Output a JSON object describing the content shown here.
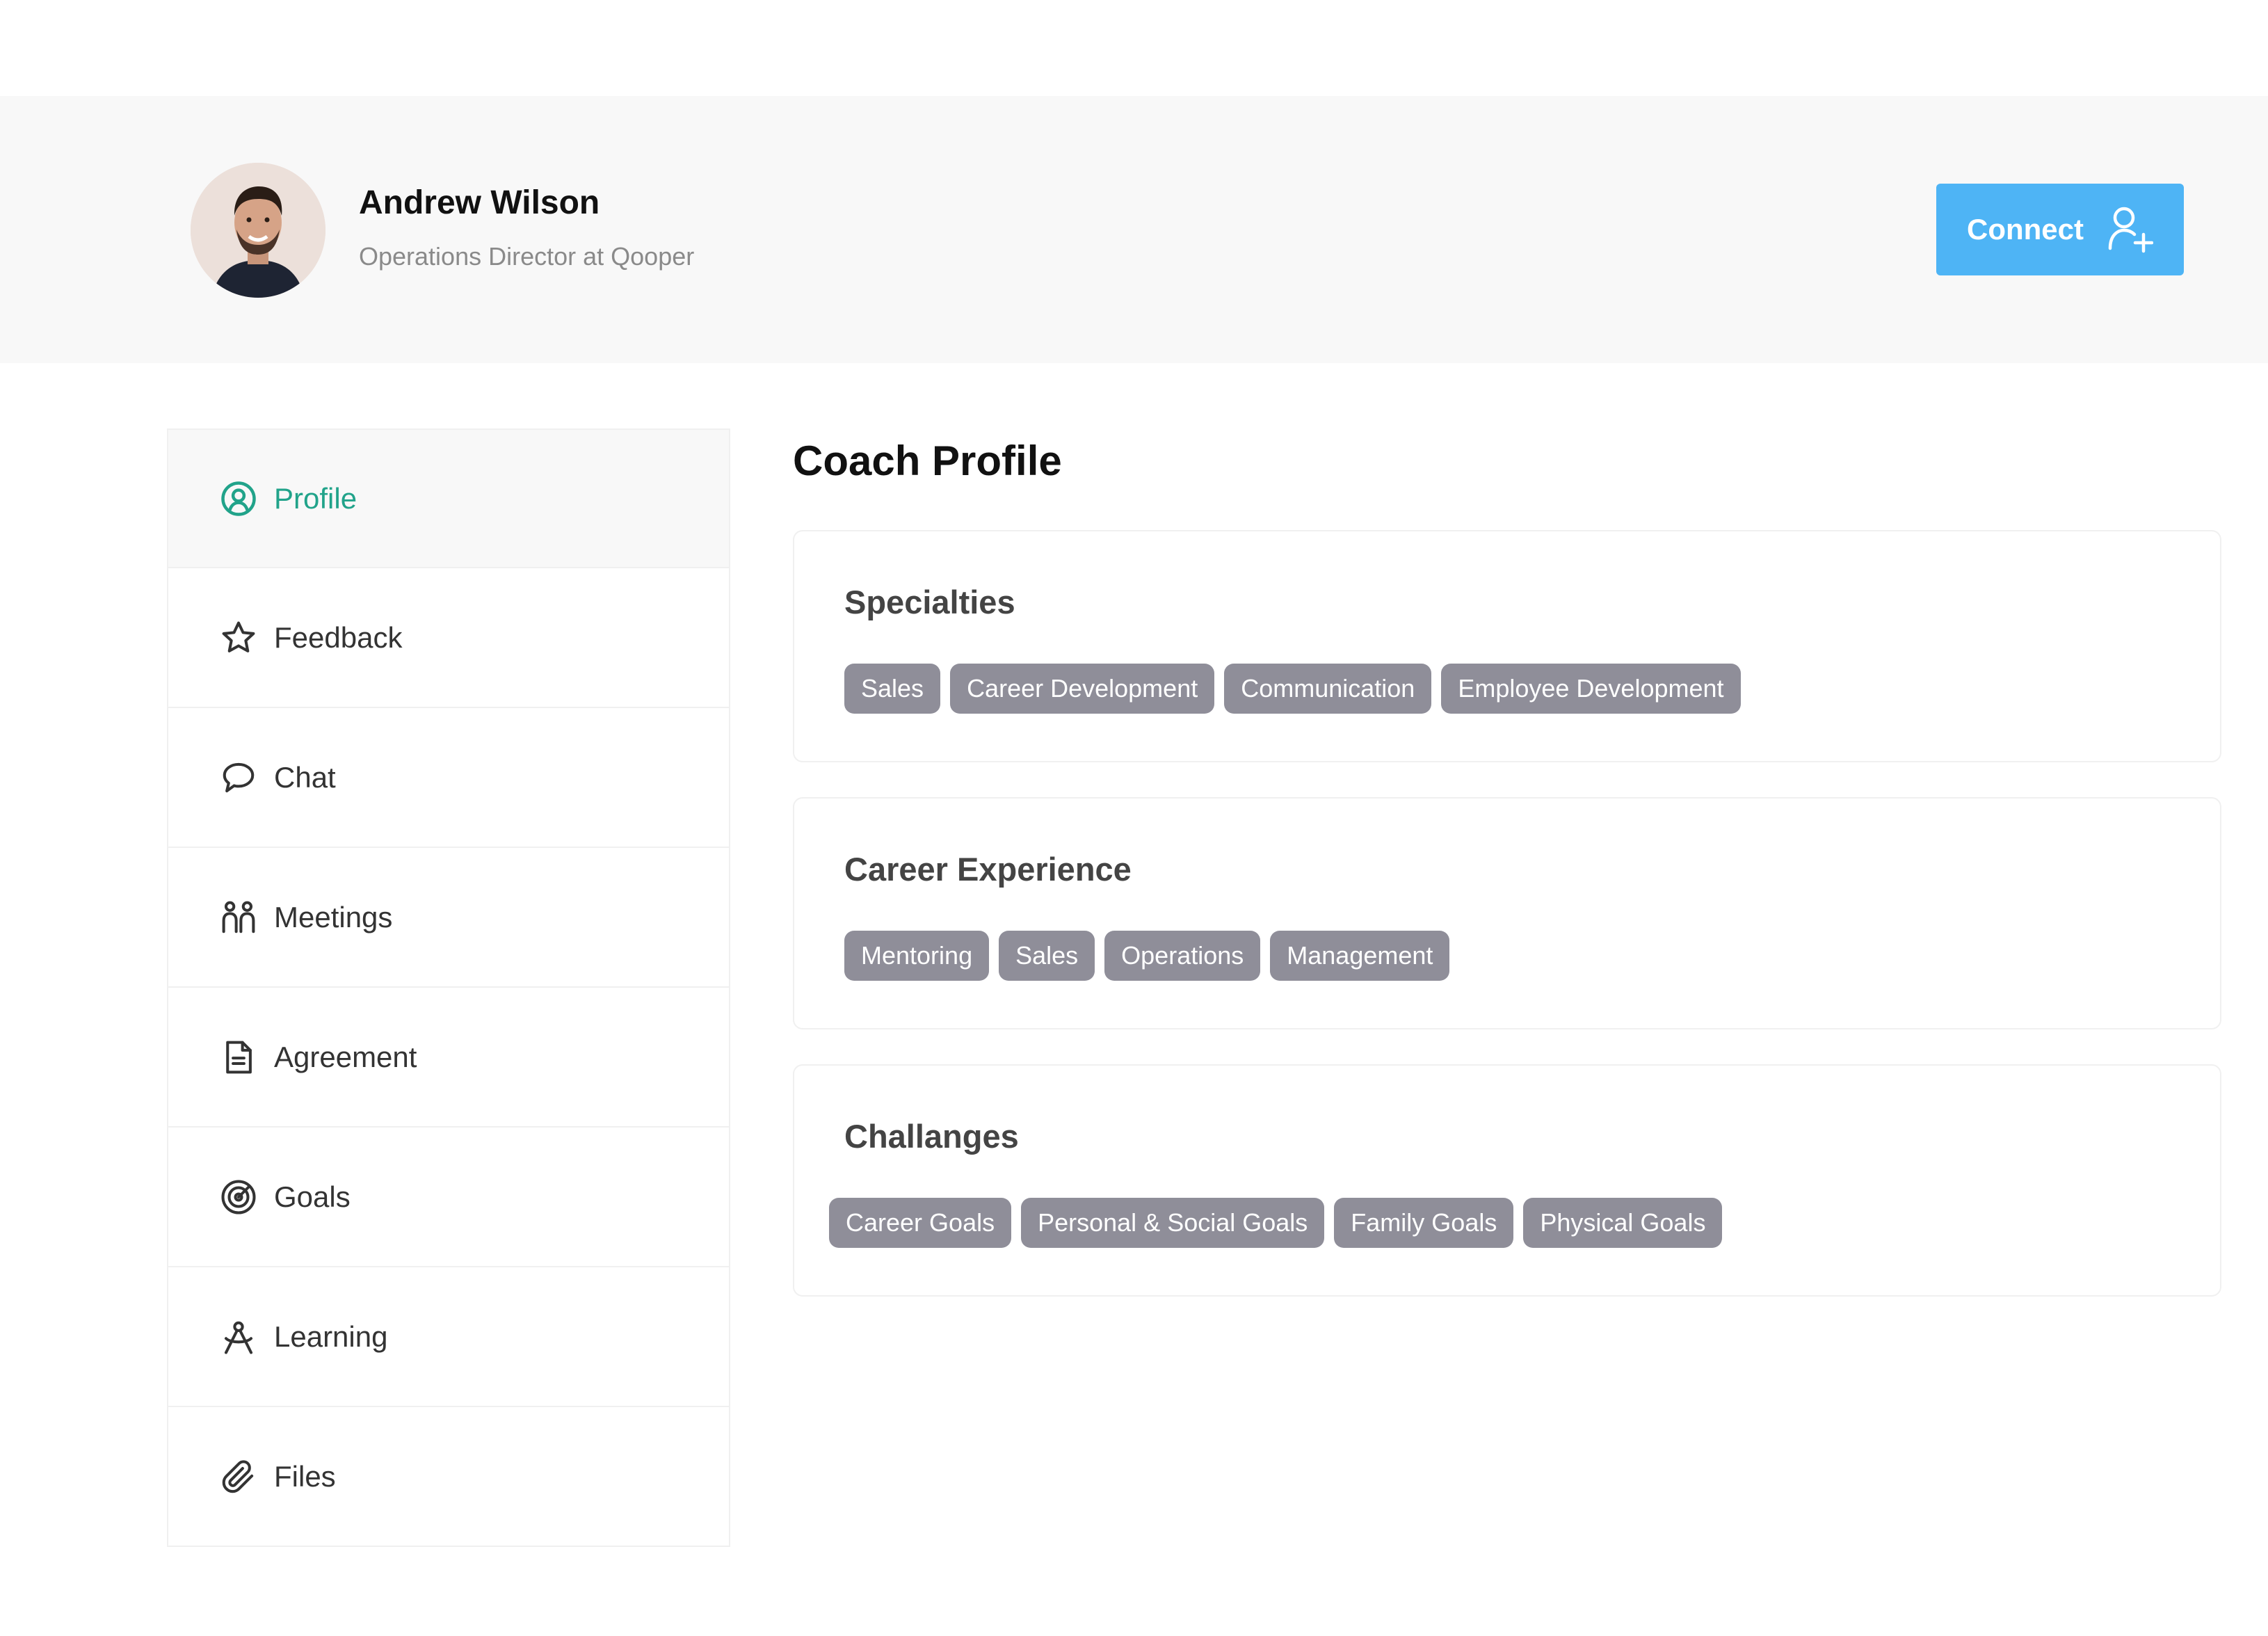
{
  "header": {
    "name": "Andrew Wilson",
    "role": "Operations Director at Qooper",
    "connect_label": "Connect"
  },
  "sidebar": {
    "items": [
      {
        "label": "Profile",
        "icon": "user-circle-icon",
        "active": true
      },
      {
        "label": "Feedback",
        "icon": "star-icon"
      },
      {
        "label": "Chat",
        "icon": "chat-bubble-icon"
      },
      {
        "label": "Meetings",
        "icon": "people-icon"
      },
      {
        "label": "Agreement",
        "icon": "document-icon"
      },
      {
        "label": "Goals",
        "icon": "target-icon"
      },
      {
        "label": "Learning",
        "icon": "compass-icon"
      },
      {
        "label": "Files",
        "icon": "paperclip-icon"
      }
    ]
  },
  "main": {
    "title": "Coach Profile",
    "sections": [
      {
        "title": "Specialties",
        "tags": [
          "Sales",
          "Career Development",
          "Communication",
          "Employee Development"
        ]
      },
      {
        "title": "Career Experience",
        "tags": [
          "Mentoring",
          "Sales",
          "Operations",
          "Management"
        ]
      },
      {
        "title": "Challanges",
        "tags": [
          "Career Goals",
          "Personal & Social Goals",
          "Family Goals",
          "Physical Goals"
        ]
      }
    ]
  },
  "colors": {
    "accent_green": "#21a38a",
    "connect_blue": "#4eb4f5",
    "tag_gray": "#8f8e99",
    "header_bg": "#f8f8f8"
  }
}
